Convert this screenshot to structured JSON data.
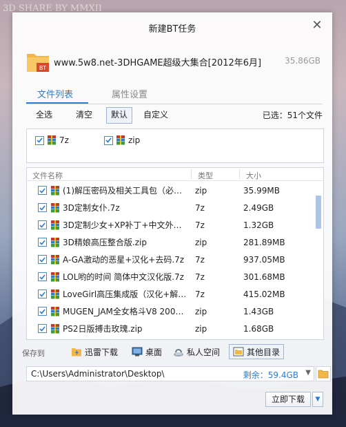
{
  "background_watermark": "3D SHARE BY MMXII",
  "window": {
    "title": "新建BT任务"
  },
  "task": {
    "name": "www.5w8.net-3DHGAME超级大集合[2012年6月]",
    "size": "35.86GB",
    "file_icon_badge": "BT"
  },
  "tabs": [
    {
      "label": "文件列表",
      "active": true
    },
    {
      "label": "属性设置",
      "active": false
    }
  ],
  "filter": {
    "buttons": [
      {
        "label": "全选",
        "selected": false
      },
      {
        "label": "清空",
        "selected": false
      },
      {
        "label": "默认",
        "selected": true
      },
      {
        "label": "自定义",
        "selected": false
      }
    ],
    "selected_count": "已选：51个文件"
  },
  "types": [
    {
      "label": "7z",
      "checked": true,
      "icon": "winrar-archive-icon"
    },
    {
      "label": "zip",
      "checked": true,
      "icon": "winrar-archive-icon"
    }
  ],
  "list": {
    "headers": {
      "name": "文件名称",
      "type": "类型",
      "size": "大小"
    },
    "rows": [
      {
        "name": "(1)解压密码及相关工具包（必下…",
        "type": "zip",
        "size": "35.99MB"
      },
      {
        "name": "3D定制女仆.7z",
        "type": "7z",
        "size": "2.49GB"
      },
      {
        "name": "3D定制少女+XP补丁+中文外挂…",
        "type": "7z",
        "size": "1.32GB"
      },
      {
        "name": "3D精娘高压整合版.zip",
        "type": "zip",
        "size": "281.89MB"
      },
      {
        "name": "A-GA激动的恶星+汉化+去码.7z",
        "type": "7z",
        "size": "937.05MB"
      },
      {
        "name": "LOL哟的时间 简体中文汉化版.7z",
        "type": "7z",
        "size": "301.68MB"
      },
      {
        "name": "LoveGirl高压集成版（汉化+解码…",
        "type": "7z",
        "size": "415.02MB"
      },
      {
        "name": "MUGEN_JAM全女格斗V8 2009黑…",
        "type": "zip",
        "size": "1.43GB"
      },
      {
        "name": "PS2日版搏击玫瑰.zip",
        "type": "zip",
        "size": "1.68GB"
      }
    ]
  },
  "save": {
    "label": "保存到",
    "targets": [
      {
        "label": "迅雷下载",
        "icon": "thunder-folder-icon",
        "selected": false
      },
      {
        "label": "桌面",
        "icon": "desktop-icon",
        "selected": false
      },
      {
        "label": "私人空间",
        "icon": "private-space-icon",
        "selected": false
      },
      {
        "label": "其他目录",
        "icon": "other-folder-icon",
        "selected": true
      }
    ],
    "path": "C:\\Users\\Administrator\\Desktop\\",
    "free_space": "剩余：59.4GB"
  },
  "actions": {
    "download_now": "立即下载"
  },
  "colors": {
    "accent": "#2b7bd2",
    "checkbox": "#3f8ad1",
    "folder": "#f2b64a"
  }
}
